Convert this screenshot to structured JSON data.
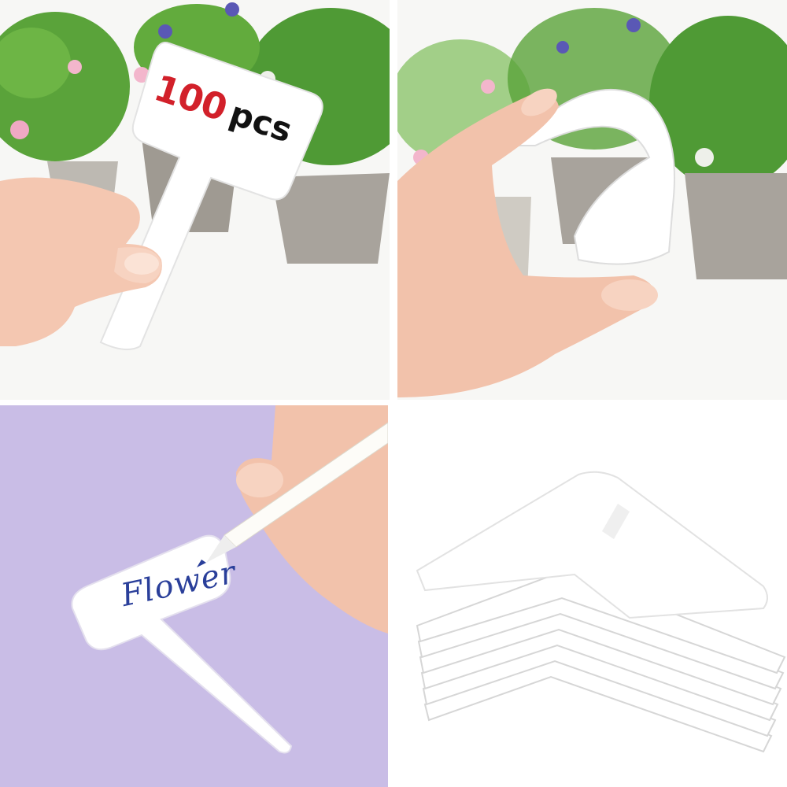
{
  "images": [
    {
      "panel": "top-left",
      "subject": "hand-holding-plant-label",
      "label_number": "100",
      "label_unit": "pcs"
    },
    {
      "panel": "top-right",
      "subject": "hand-bending-plant-label"
    },
    {
      "panel": "bottom-left",
      "subject": "hand-writing-on-plant-label",
      "handwritten_text": "Flower"
    },
    {
      "panel": "bottom-right",
      "subject": "stack-of-plant-labels"
    }
  ],
  "colors": {
    "label_number": "#d2202a",
    "label_unit": "#111111",
    "handwriting_ink": "#2a3f9a",
    "lavender_background": "#c9bde6",
    "foliage": "#4f9a35",
    "pot": "#a8a39c"
  }
}
